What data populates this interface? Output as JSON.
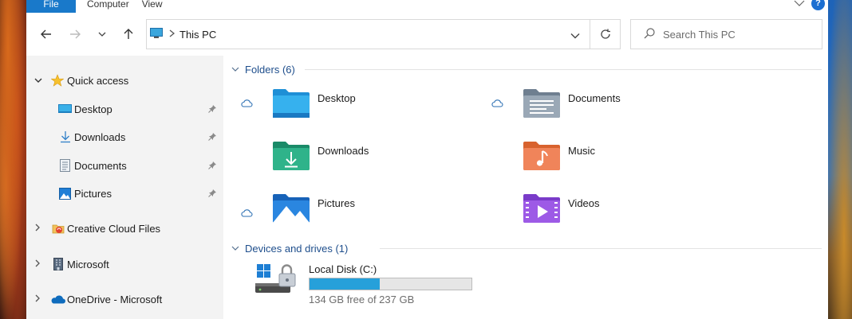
{
  "ribbon": {
    "tabs": [
      "File",
      "Computer",
      "View"
    ],
    "help": "?"
  },
  "address": {
    "path": "This PC",
    "search_placeholder": "Search This PC"
  },
  "sidebar": {
    "quick_access": "Quick access",
    "pinned": [
      {
        "label": "Desktop",
        "icon": "desktop-icon"
      },
      {
        "label": "Downloads",
        "icon": "download-icon"
      },
      {
        "label": "Documents",
        "icon": "documents-icon"
      },
      {
        "label": "Pictures",
        "icon": "pictures-icon"
      }
    ],
    "roots": [
      {
        "label": "Creative Cloud Files",
        "icon": "creative-cloud-icon"
      },
      {
        "label": "Microsoft",
        "icon": "building-icon"
      },
      {
        "label": "OneDrive - Microsoft",
        "icon": "onedrive-icon"
      }
    ]
  },
  "content": {
    "folders_header": "Folders (6)",
    "folders": [
      {
        "name": "Desktop",
        "icon": "desktop-folder-icon",
        "cloud": true
      },
      {
        "name": "Documents",
        "icon": "documents-folder-icon",
        "cloud": true
      },
      {
        "name": "Downloads",
        "icon": "downloads-folder-icon",
        "cloud": false
      },
      {
        "name": "Music",
        "icon": "music-folder-icon",
        "cloud": false
      },
      {
        "name": "Pictures",
        "icon": "pictures-folder-icon",
        "cloud": true
      },
      {
        "name": "Videos",
        "icon": "videos-folder-icon",
        "cloud": false
      }
    ],
    "drives_header": "Devices and drives (1)",
    "drive": {
      "name": "Local Disk (C:)",
      "free_text": "134 GB free of 237 GB",
      "used_fraction": 0.435
    }
  },
  "colors": {
    "accent": "#1979ca",
    "drive_bar": "#26a0da",
    "group_header": "#1e4e8c"
  }
}
